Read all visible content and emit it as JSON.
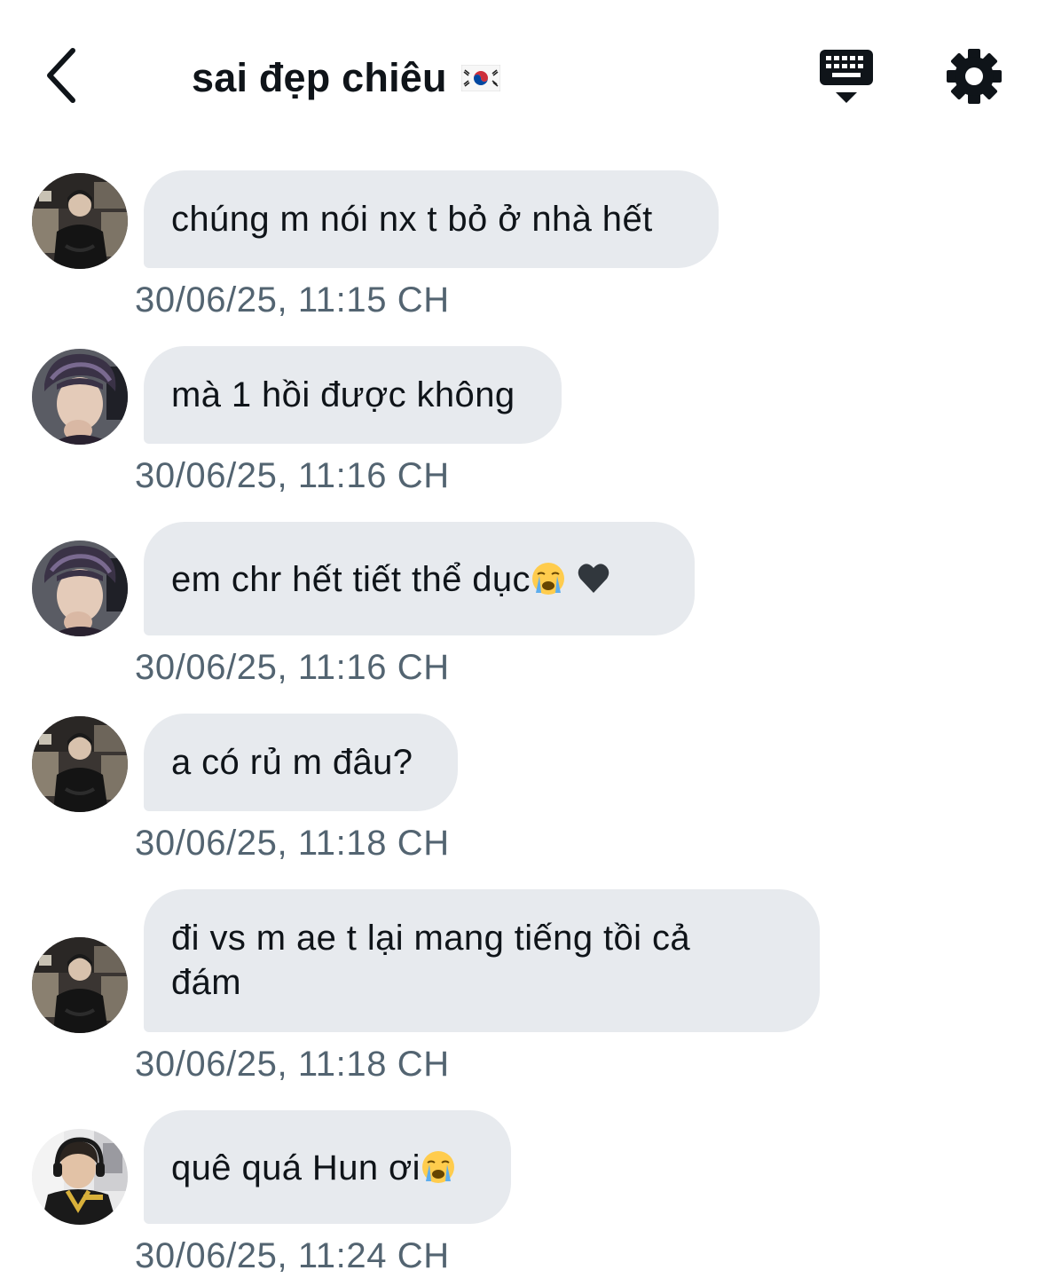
{
  "header": {
    "title": "sai đẹp chiêu",
    "flag_icon": "south-korea-flag-icon",
    "back_icon": "chevron-left-icon",
    "keyboard_icon": "keyboard-icon",
    "settings_icon": "gear-icon"
  },
  "colors": {
    "bubble_bg": "#e7eaee",
    "timestamp": "#536471",
    "text": "#0f1419"
  },
  "messages": [
    {
      "text": "chúng m nói nx t bỏ ở nhà hết",
      "time": "30/06/25, 11:15 CH",
      "avatar": "avatar-a"
    },
    {
      "text": "mà 1 hồi được không",
      "time": "30/06/25, 11:16 CH",
      "avatar": "avatar-b"
    },
    {
      "text": "em chr hết tiết thể dục",
      "emojis": [
        "crying-face-icon",
        "black-heart-icon"
      ],
      "time": "30/06/25, 11:16 CH",
      "avatar": "avatar-b"
    },
    {
      "text": "a có rủ m đâu?",
      "time": "30/06/25, 11:18 CH",
      "avatar": "avatar-a"
    },
    {
      "text_line1": "đi vs m ae t lại mang tiếng tồi cả",
      "text_line2": "đám",
      "time": "30/06/25, 11:18 CH",
      "avatar": "avatar-a"
    },
    {
      "text": "quê quá Hun ơi",
      "emojis": [
        "crying-face-icon"
      ],
      "time": "30/06/25, 11:24 CH",
      "avatar": "avatar-c"
    }
  ]
}
